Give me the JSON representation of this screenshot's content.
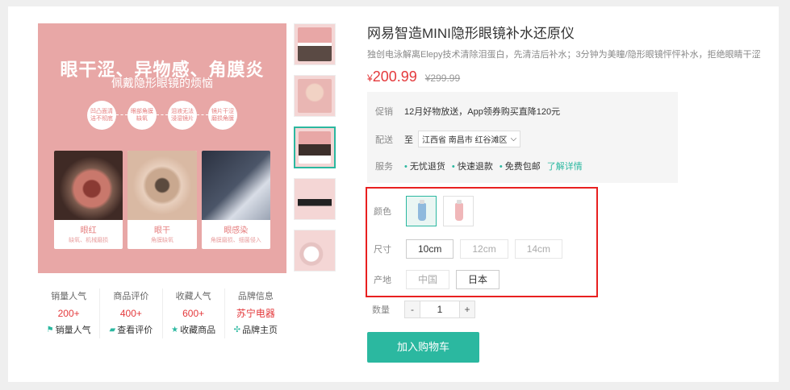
{
  "colors": {
    "accent": "#2bb8a0",
    "price": "#e4393c",
    "highlight_border": "#e82020",
    "hero_bg": "#e8a7a6"
  },
  "hero": {
    "title": "眼干涩、异物感、角膜炎",
    "subtitle": "佩戴隐形眼镜的烦恼",
    "bubbles": [
      "凹凸面清洁不彻底",
      "眼部角膜缺氧",
      "泪液无法浸湿镜片",
      "镜片干涩磨损角膜"
    ],
    "photos": [
      {
        "caption": "眼红",
        "sub": "缺氧、机械磨损"
      },
      {
        "caption": "眼干",
        "sub": "角膜缺氧"
      },
      {
        "caption": "眼感染",
        "sub": "角膜磨损、细菌侵入"
      }
    ]
  },
  "stats": [
    {
      "label": "销量人气",
      "value": "200+",
      "link": "销量人气",
      "icon": "flag-icon"
    },
    {
      "label": "商品评价",
      "value": "400+",
      "link": "查看评价",
      "icon": "comment-icon"
    },
    {
      "label": "收藏人气",
      "value": "600+",
      "link": "收藏商品",
      "icon": "star-icon"
    },
    {
      "label": "品牌信息",
      "value": "苏宁电器",
      "link": "品牌主页",
      "icon": "brand-icon"
    }
  ],
  "product": {
    "title": "网易智造MINI隐形眼镜补水还原仪",
    "description": "独创电泳解离Elepy技术清除泪蛋白，先清洁后补水；3分钟为美瞳/隐形眼镜怦怦补水，拒绝眼睛干涩",
    "currency": "¥",
    "price": "200.99",
    "old_price": "¥299.99"
  },
  "promo": {
    "label": "促销",
    "text": "12月好物放送，App领券购买直降120元",
    "delivery_label": "配送",
    "delivery_prefix": "至",
    "address": "江西省 南昌市 红谷滩区",
    "service_label": "服务",
    "services": [
      "无忧退货",
      "快速退款",
      "免费包邮"
    ],
    "more": "了解详情"
  },
  "specs": {
    "color_label": "颜色",
    "size_label": "尺寸",
    "sizes": [
      "10cm",
      "12cm",
      "14cm"
    ],
    "origin_label": "产地",
    "origins": [
      "中国",
      "日本"
    ]
  },
  "quantity": {
    "label": "数量",
    "value": "1",
    "minus": "-",
    "plus": "+"
  },
  "cart_button": "加入购物车"
}
